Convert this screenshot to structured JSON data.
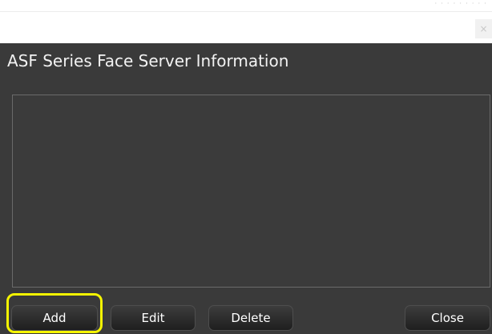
{
  "top_strip": {
    "text": "· · · · · · · · ·"
  },
  "window": {
    "close_glyph": "×"
  },
  "dialog": {
    "title": "ASF Series Face Server Information",
    "buttons": {
      "add": "Add",
      "edit": "Edit",
      "delete": "Delete",
      "close": "Close"
    }
  },
  "highlight": {
    "target": "add-button",
    "color": "#f5f500"
  },
  "colors": {
    "dialog_background": "#3a3a3a",
    "text": "#ffffff",
    "highlight": "#f5f500"
  }
}
